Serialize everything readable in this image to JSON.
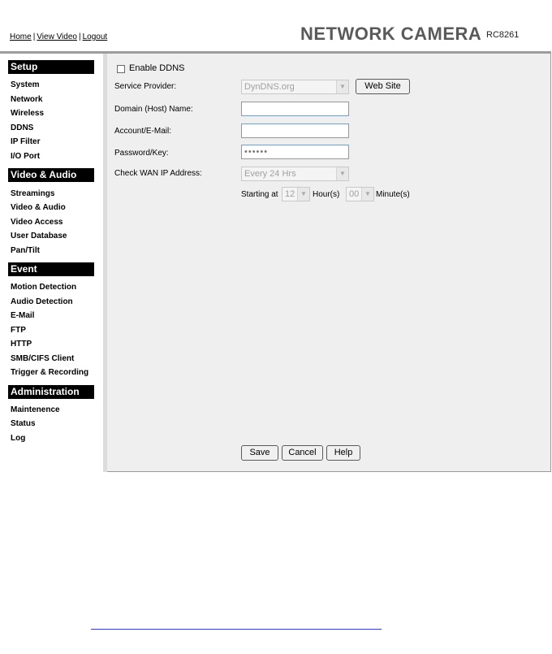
{
  "header": {
    "links": [
      "Home",
      "View Video",
      "Logout"
    ],
    "separator": "|",
    "brand": "NETWORK CAMERA",
    "model": "RC8261"
  },
  "sidebar": {
    "sections": [
      {
        "title": "Setup",
        "items": [
          "System",
          "Network",
          "Wireless",
          "DDNS",
          "IP Filter",
          "I/O Port"
        ]
      },
      {
        "title": "Video & Audio",
        "items": [
          "Streamings",
          "Video & Audio",
          "Video Access",
          "User Database",
          "Pan/Tilt"
        ]
      },
      {
        "title": "Event",
        "items": [
          "Motion Detection",
          "Audio Detection",
          "E-Mail",
          "FTP",
          "HTTP",
          "SMB/CIFS Client",
          "Trigger & Recording"
        ]
      },
      {
        "title": "Administration",
        "items": [
          "Maintenence",
          "Status",
          "Log"
        ]
      }
    ],
    "active_item": "DDNS"
  },
  "form": {
    "enable_label": "Enable DDNS",
    "enable_checked": false,
    "service_provider_label": "Service Provider:",
    "service_provider_value": "DynDNS.org",
    "web_site_button": "Web Site",
    "domain_label": "Domain (Host) Name:",
    "domain_value": "",
    "account_label": "Account/E-Mail:",
    "account_value": "",
    "password_label": "Password/Key:",
    "password_value": "••••••",
    "check_wan_label": "Check WAN IP Address:",
    "check_wan_value": "Every 24 Hrs",
    "starting_at_label": "Starting at",
    "hour_value": "12",
    "hour_label": "Hour(s)",
    "minute_value": "00",
    "minute_label": "Minute(s)"
  },
  "actions": {
    "save": "Save",
    "cancel": "Cancel",
    "help": "Help"
  },
  "icons": {
    "dropdown": "chevron-down-icon"
  }
}
